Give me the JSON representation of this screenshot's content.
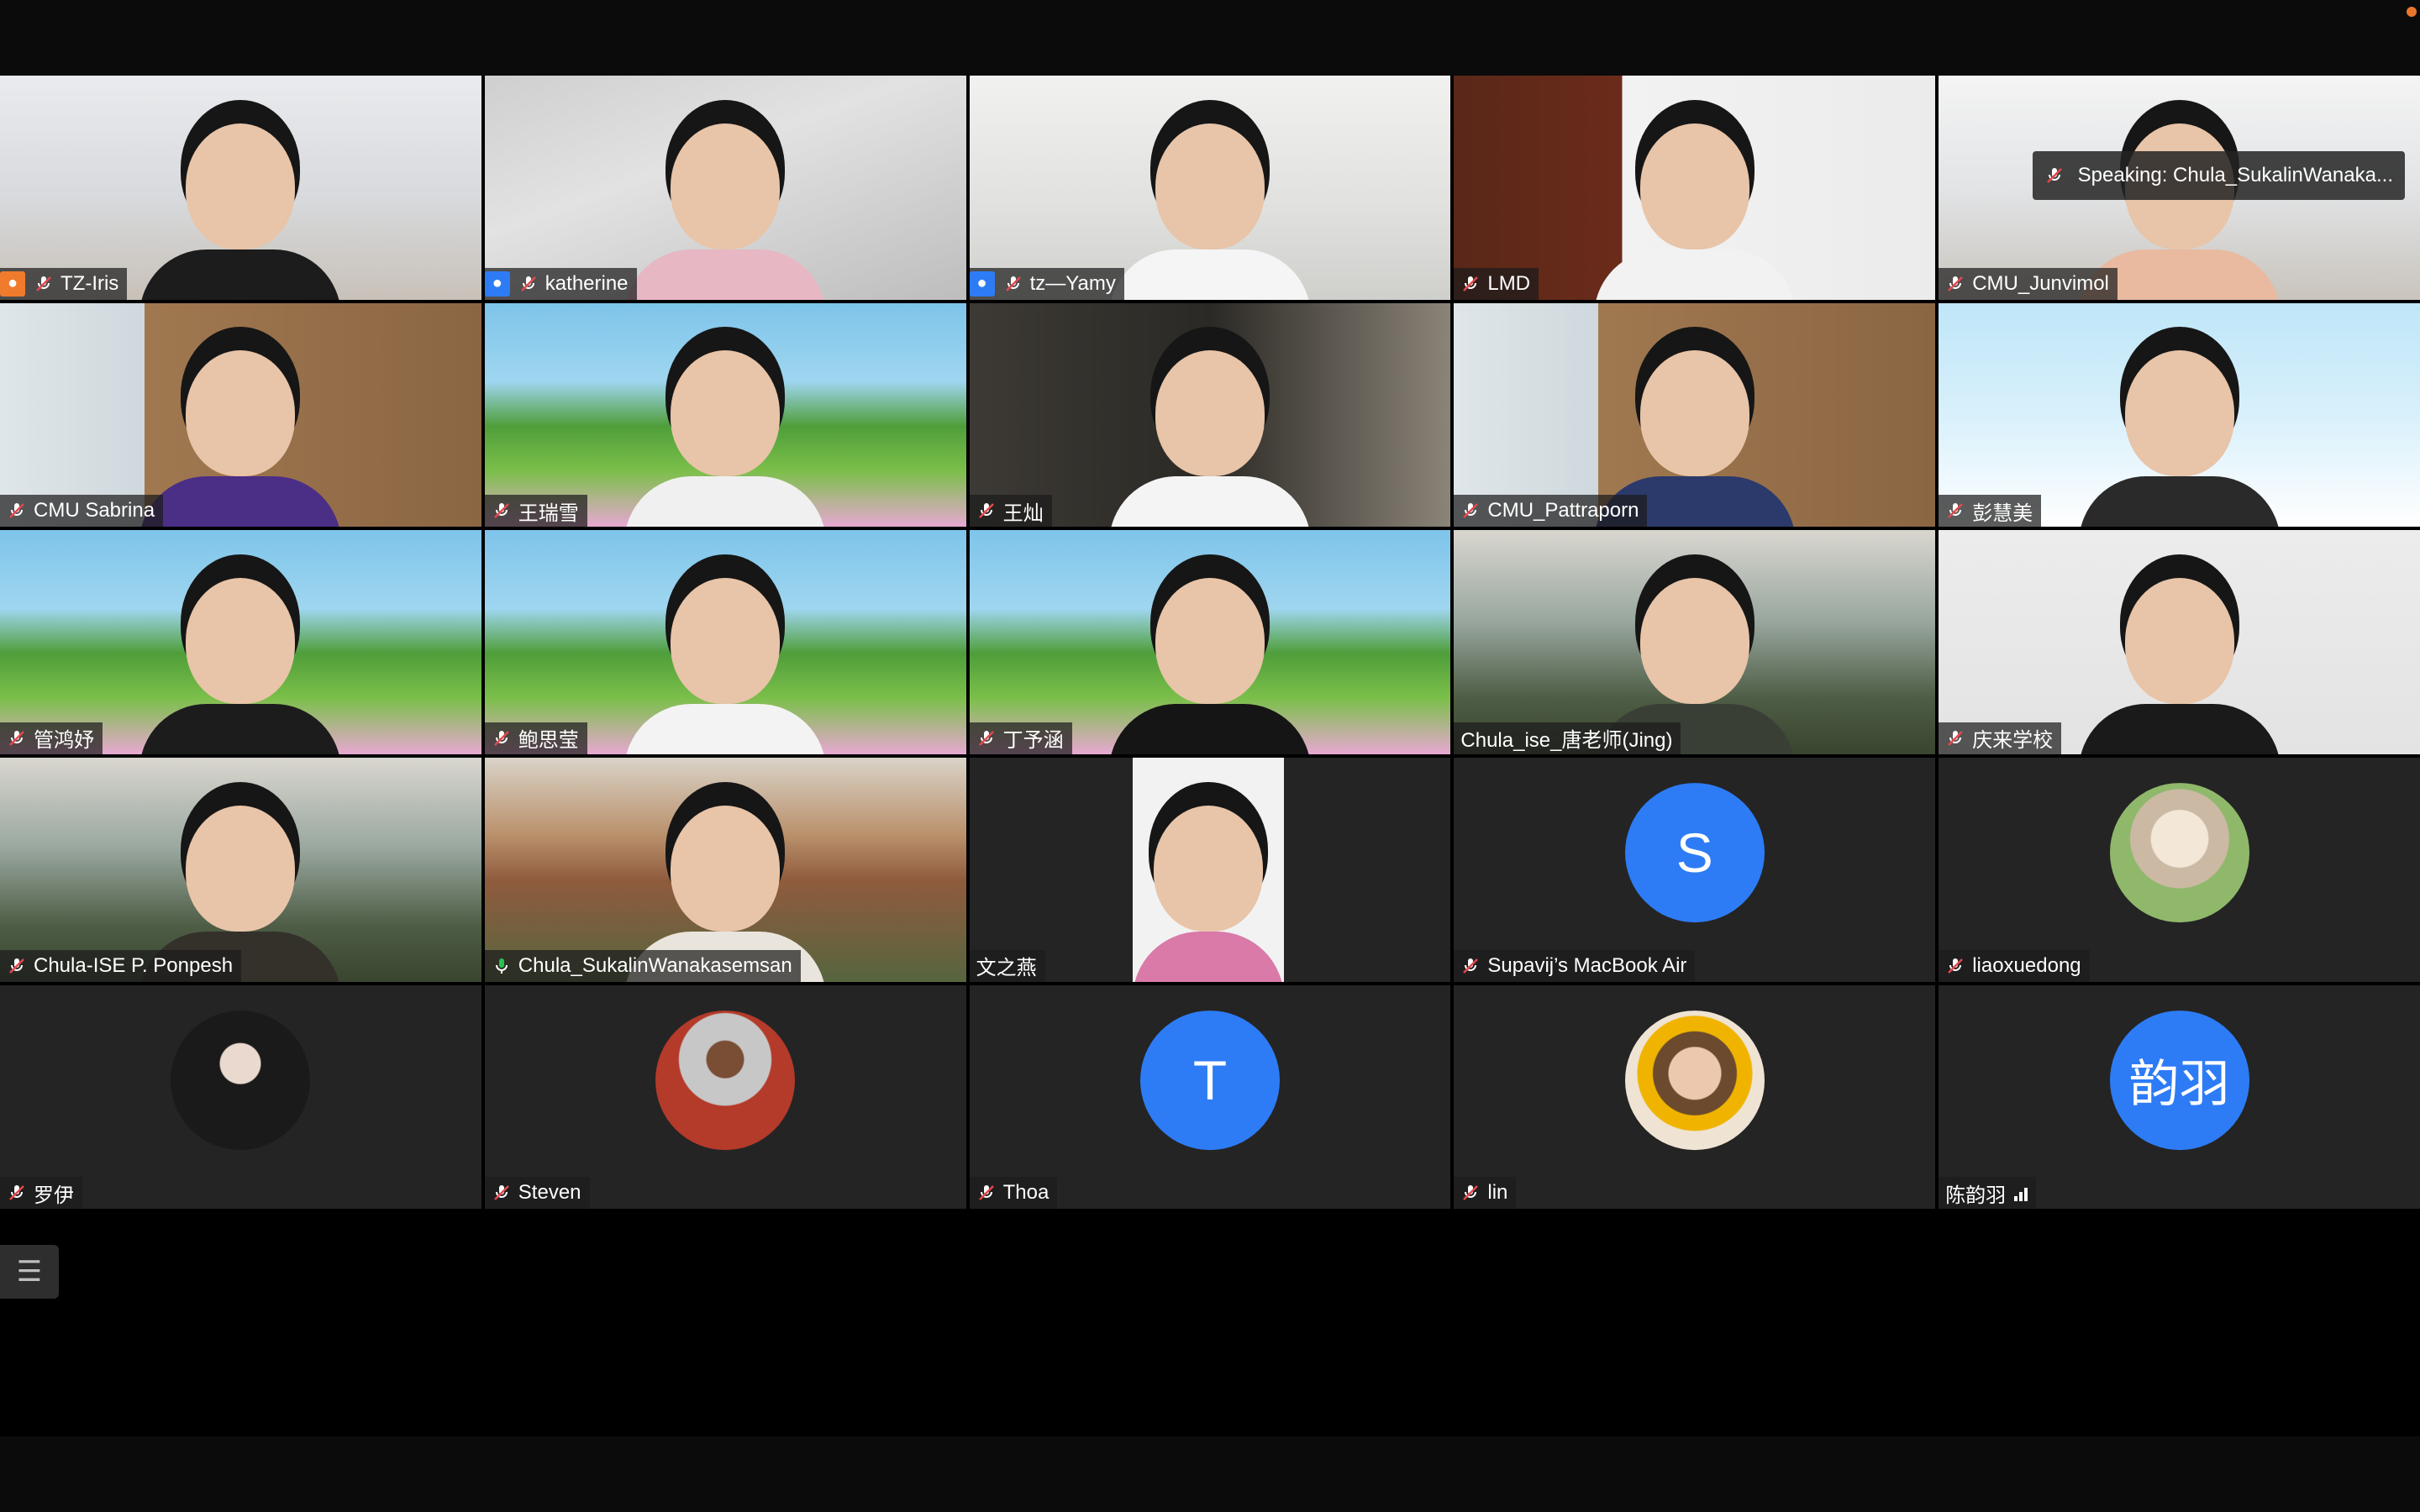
{
  "app": {
    "record_dot_color": "#e8772e"
  },
  "speaking_banner": {
    "label": "Speaking: Chula_SukalinWanaka..."
  },
  "participants": [
    {
      "name": "TZ-Iris",
      "mic": "muted",
      "user_icon": "orange-user"
    },
    {
      "name": "katherine",
      "mic": "muted",
      "user_icon": "blue-user"
    },
    {
      "name": "tz—Yamy",
      "mic": "muted",
      "user_icon": "blue-user"
    },
    {
      "name": "LMD",
      "mic": "muted"
    },
    {
      "name": "CMU_Junvimol",
      "mic": "muted"
    },
    {
      "name": "CMU Sabrina",
      "mic": "muted"
    },
    {
      "name": "王瑞雪",
      "mic": "muted"
    },
    {
      "name": "王灿",
      "mic": "muted"
    },
    {
      "name": "CMU_Pattraporn",
      "mic": "muted"
    },
    {
      "name": "彭慧美",
      "mic": "muted"
    },
    {
      "name": "管鸿妤",
      "mic": "muted"
    },
    {
      "name": "鲍思莹",
      "mic": "muted"
    },
    {
      "name": "丁予涵",
      "mic": "muted"
    },
    {
      "name": "Chula_ise_唐老师(Jing)",
      "mic": "none"
    },
    {
      "name": "庆来学校",
      "mic": "muted"
    },
    {
      "name": "Chula-ISE P. Ponpesh",
      "mic": "muted"
    },
    {
      "name": "Chula_SukalinWanakasemsan",
      "mic": "active",
      "speaking": true
    },
    {
      "name": "文之燕",
      "mic": "none"
    },
    {
      "name": "Supavij’s MacBook Air",
      "mic": "muted",
      "avatar_letter": "S"
    },
    {
      "name": "liaoxuedong",
      "mic": "muted"
    },
    {
      "name": "罗伊",
      "mic": "muted"
    },
    {
      "name": "Steven",
      "mic": "muted"
    },
    {
      "name": "Thoa",
      "mic": "muted",
      "avatar_letter": "T"
    },
    {
      "name": "lin",
      "mic": "muted"
    },
    {
      "name": "陈韵羽",
      "mic": "active-level",
      "avatar_text": "韵羽"
    }
  ],
  "colors": {
    "speaking_border": "#25c451",
    "avatar_blue": "#2d7cf6",
    "muted_mic": "#e5484d"
  }
}
